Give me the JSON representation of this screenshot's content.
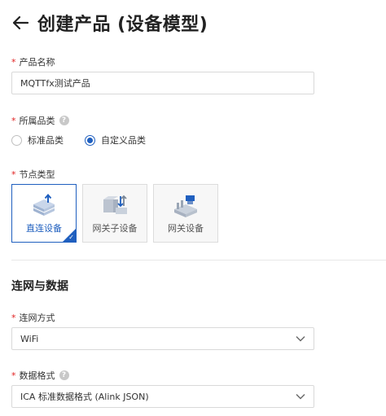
{
  "header": {
    "title": "创建产品 (设备模型)",
    "back_icon": "arrow-left-icon"
  },
  "product_name": {
    "label": "产品名称",
    "value": "MQTTfx测试产品"
  },
  "category": {
    "label": "所属品类",
    "options": [
      {
        "label": "标准品类",
        "checked": false
      },
      {
        "label": "自定义品类",
        "checked": true
      }
    ]
  },
  "node_type": {
    "label": "节点类型",
    "cards": [
      {
        "label": "直连设备",
        "icon": "direct-device-icon",
        "selected": true
      },
      {
        "label": "网关子设备",
        "icon": "gateway-sub-device-icon",
        "selected": false
      },
      {
        "label": "网关设备",
        "icon": "gateway-device-icon",
        "selected": false
      }
    ]
  },
  "network_section": {
    "title": "连网与数据"
  },
  "network_method": {
    "label": "连网方式",
    "value": "WiFi"
  },
  "data_format": {
    "label": "数据格式",
    "value": "ICA 标准数据格式 (Alink JSON)"
  },
  "colors": {
    "accent": "#1f5fbf",
    "required": "#e02020"
  }
}
